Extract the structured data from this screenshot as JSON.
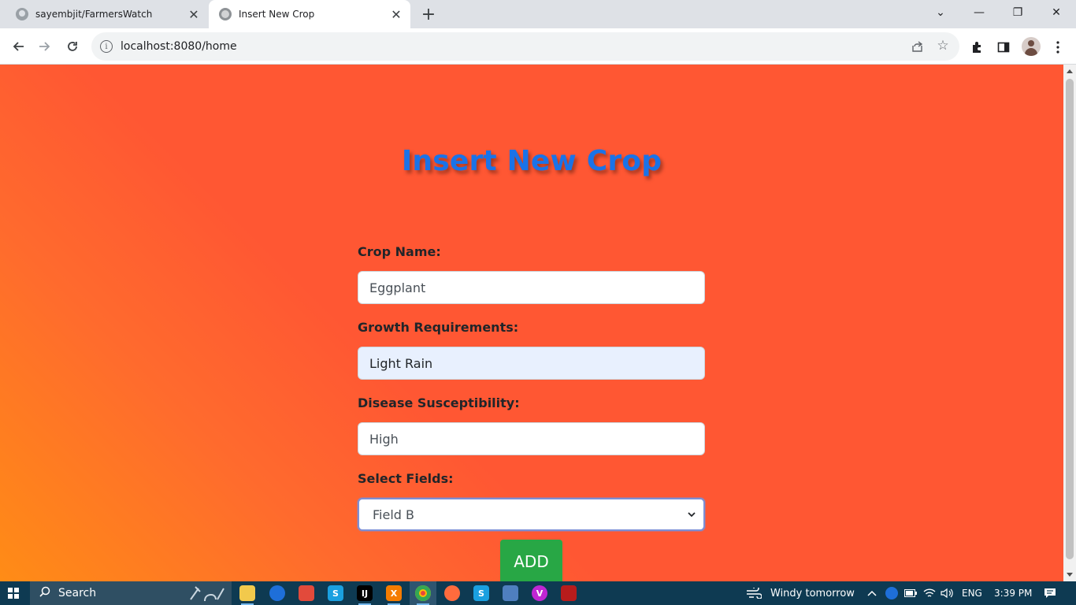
{
  "browser": {
    "tabs": [
      {
        "title": "sayembjit/FarmersWatch",
        "active": false
      },
      {
        "title": "Insert New Crop",
        "active": true
      }
    ],
    "new_tab_symbol": "+",
    "close_symbol": "✕",
    "url": "localhost:8080/home",
    "window_controls": {
      "minimize": "—",
      "restore": "❐",
      "close": "✕",
      "tab_search": "⌄"
    }
  },
  "page": {
    "heading": "Insert New Crop",
    "form": {
      "crop_name_label": "Crop Name:",
      "crop_name_value": "Eggplant",
      "growth_label": "Growth Requirements:",
      "growth_value": "Light Rain",
      "disease_label": "Disease Susceptibility:",
      "disease_value": "High",
      "fields_label": "Select Fields:",
      "fields_selected": "Field B",
      "add_button": "ADD"
    }
  },
  "taskbar": {
    "search_label": "Search",
    "weather": "Windy tomorrow",
    "language": "ENG",
    "time": "3:39 PM"
  },
  "colors": {
    "page_bg": "#ff5733",
    "gradient_corner": "#ff8c16",
    "heading": "#1a73e8",
    "add_button": "#28a745",
    "taskbar": "#0e3a52"
  },
  "icons": [
    "github-icon",
    "globe-icon",
    "back-arrow-icon",
    "forward-arrow-icon",
    "reload-icon",
    "info-icon",
    "share-icon",
    "star-icon",
    "extensions-icon",
    "side-panel-icon",
    "profile-icon",
    "kebab-menu-icon",
    "windows-start-icon",
    "search-icon",
    "weather-icon"
  ]
}
